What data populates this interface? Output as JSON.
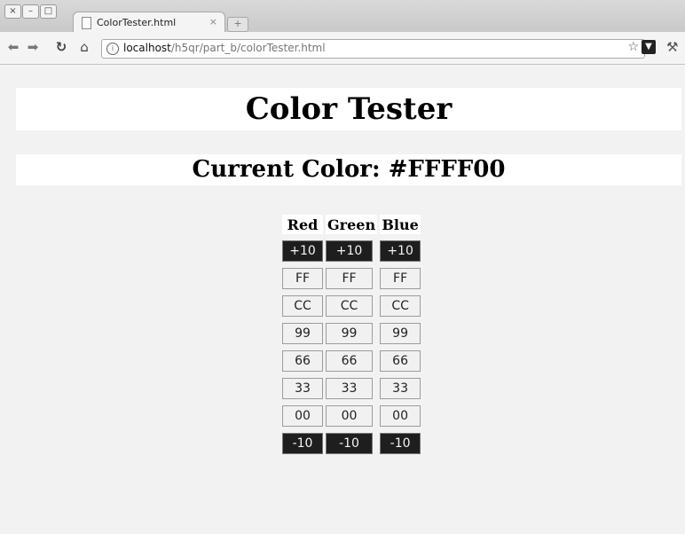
{
  "browser": {
    "tab_title": "ColorTester.html",
    "tab_close": "×",
    "new_tab": "+",
    "url_host": "localhost",
    "url_path": "/h5qr/part_b/colorTester.html",
    "window_close": "×",
    "window_minimize": "–",
    "window_maximize": "□",
    "icons": {
      "back": "back-arrow-icon",
      "forward": "forward-arrow-icon",
      "reload": "reload-icon",
      "home": "home-icon",
      "bookmark": "star-icon",
      "extension": "extension-icon",
      "settings": "wrench-icon"
    }
  },
  "page": {
    "title": "Color Tester",
    "current_color_text": "Current Color: #FFFF00",
    "columns": [
      "Red",
      "Green",
      "Blue"
    ],
    "rows": [
      {
        "label": "+10",
        "style": "dark"
      },
      {
        "label": "FF",
        "style": "light"
      },
      {
        "label": "CC",
        "style": "light"
      },
      {
        "label": "99",
        "style": "light"
      },
      {
        "label": "66",
        "style": "light"
      },
      {
        "label": "33",
        "style": "light"
      },
      {
        "label": "00",
        "style": "light"
      },
      {
        "label": "-10",
        "style": "dark"
      }
    ]
  }
}
